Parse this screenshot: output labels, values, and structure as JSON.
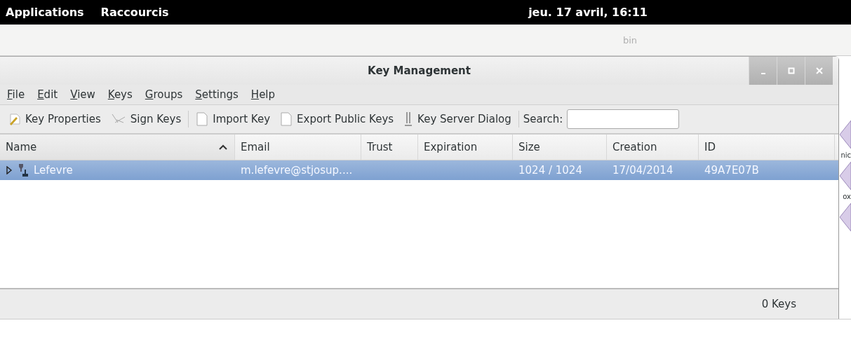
{
  "top_panel": {
    "menus": [
      "Applications",
      "Raccourcis"
    ],
    "clock": "jeu. 17 avril, 16:11"
  },
  "background_window": {
    "title": "bin"
  },
  "window": {
    "title": "Key Management"
  },
  "menu_bar": [
    "File",
    "Edit",
    "View",
    "Keys",
    "Groups",
    "Settings",
    "Help"
  ],
  "toolbar": [
    {
      "kind": "button",
      "label": "Key Properties"
    },
    {
      "kind": "button",
      "label": "Sign Keys"
    },
    {
      "kind": "separator"
    },
    {
      "kind": "button",
      "label": "Import Key"
    },
    {
      "kind": "button",
      "label": "Export Public Keys"
    },
    {
      "kind": "button",
      "label": "Key Server Dialog"
    },
    {
      "kind": "separator"
    }
  ],
  "search": {
    "label": "Search:"
  },
  "table": {
    "columns": [
      {
        "label": "Name",
        "sorted": true
      },
      {
        "label": "Email",
        "sorted": false
      },
      {
        "label": "Trust",
        "sorted": false
      },
      {
        "label": "Expiration",
        "sorted": false
      },
      {
        "label": "Size",
        "sorted": false
      },
      {
        "label": "Creation",
        "sorted": false
      },
      {
        "label": "ID",
        "sorted": false
      }
    ],
    "rows": [
      {
        "selected": true,
        "expanded": false,
        "cells": [
          "Lefevre",
          "m.lefevre@stjosup....",
          "",
          "",
          "1024 / 1024",
          "17/04/2014",
          "49A7E07B"
        ]
      }
    ]
  },
  "status_bar": {
    "count": "0 Keys"
  },
  "desktop_labels": [
    "nic",
    "ox"
  ]
}
